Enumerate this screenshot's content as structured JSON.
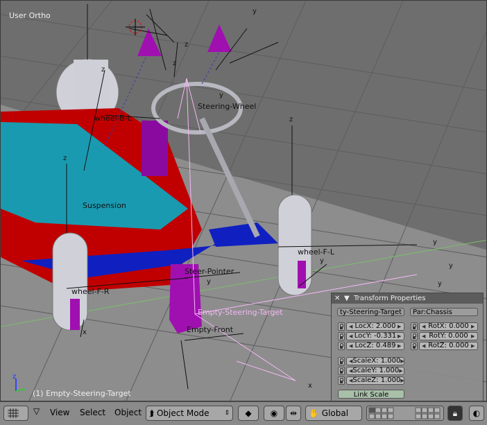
{
  "viewport": {
    "view_label": "User Ortho",
    "status_text": "(1) Empty-Steering-Target",
    "objects": {
      "wheel_bl": "wheel-B-L",
      "steering_wheel": "Steering-Wheel",
      "suspension": "Suspension",
      "wheel_fl": "wheel-F-L",
      "steer_pointer": "Steer-Pointer",
      "wheel_fr": "wheel-F-R",
      "empty_steering_target": "Empty-Steering-Target",
      "empty_front": "Empty-Front"
    },
    "axes": {
      "x": "x",
      "y": "y",
      "z": "z"
    }
  },
  "transform_panel": {
    "title": "Transform Properties",
    "object_name": "ty-Steering-Target",
    "parent": "Par:Chassis",
    "loc_x": "LocX: 2.000",
    "loc_y": "LocY: -0.331",
    "loc_z": "LocZ: 0.489",
    "rot_x": "RotX: 0.000",
    "rot_y": "RotY: 0.000",
    "rot_z": "RotZ: 0.000",
    "scale_x": "ScaleX: 1.000",
    "scale_y": "ScaleY: 1.000",
    "scale_z": "ScaleZ: 1.000",
    "link_scale": "Link Scale"
  },
  "header": {
    "menus": {
      "view": "View",
      "select": "Select",
      "object": "Object"
    },
    "mode": "Object Mode",
    "orientation": "Global"
  },
  "colors": {
    "chassis": "#c00000",
    "glass": "#1a9ab0",
    "floor": "#1020c0",
    "empties": "#a010b0",
    "wheels": "#d8d8e0",
    "selected": "#f4b8f4"
  },
  "icons": [
    "editor-type-grid-icon",
    "view-3d-icon",
    "pivot-icon",
    "transform-icon",
    "hand-icon",
    "layer-icon",
    "lock-icon",
    "render-icon"
  ]
}
